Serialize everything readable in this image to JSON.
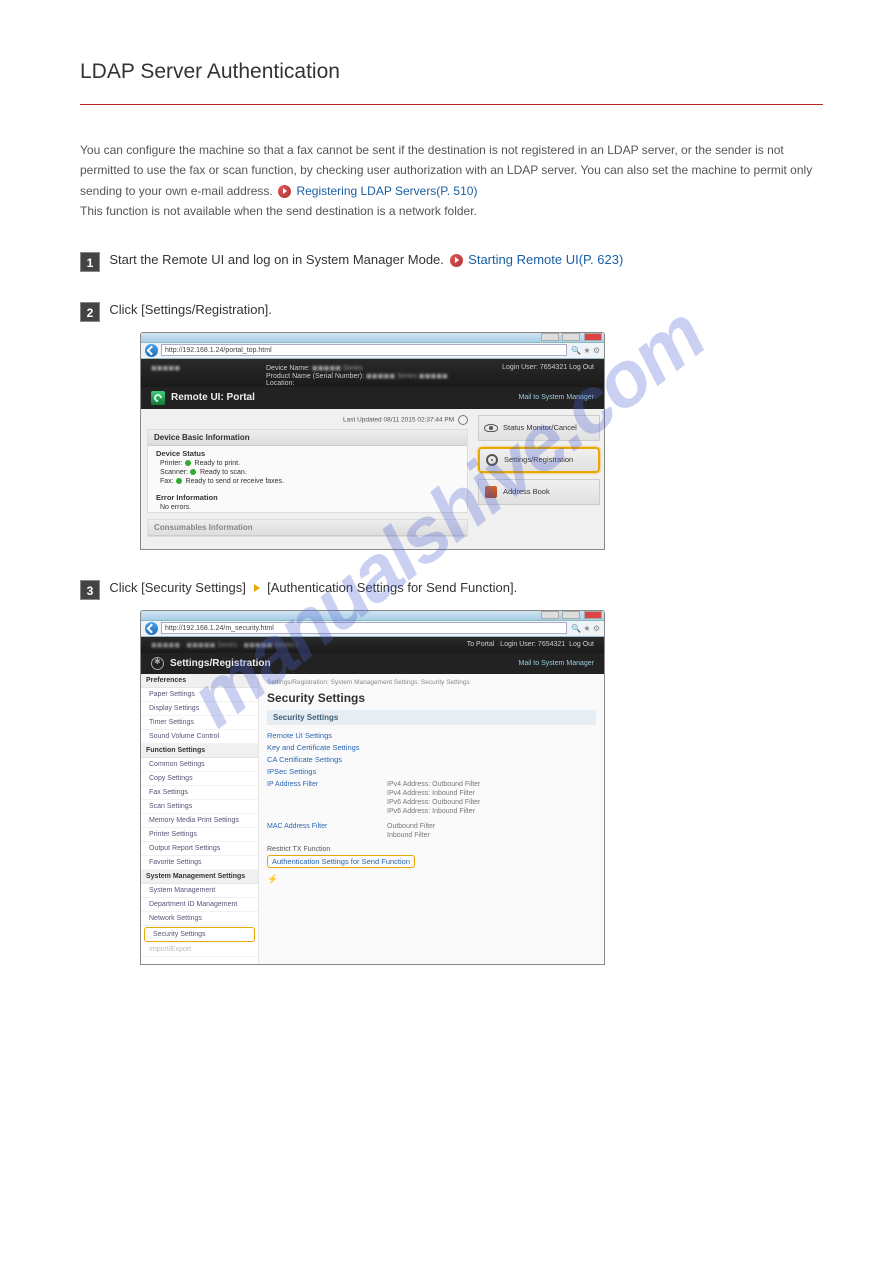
{
  "doc": {
    "title": "LDAP Server Authentication",
    "intro_1": "You can configure the machine so that a fax cannot be sent if the destination is not registered in an LDAP server, or the sender is not permitted to use the fax or scan function, by checking user authorization with an LDAP server. You can also set the machine to permit only sending to your own e-mail address.",
    "intro_link": "Registering LDAP Servers(P. 510)",
    "intro_link_prefix": " ",
    "intro_note": "This function is not available when the send destination is a network folder.",
    "step1": "Start the Remote UI and log on in System Manager Mode.",
    "step1_link": "Starting Remote UI(P. 623)",
    "step2": "Click [Settings/Registration].",
    "step3_prefix": "Click [Security Settings]",
    "step3_suffix": "[Authentication Settings for Send Function]."
  },
  "sc1": {
    "addr": "http://192.168.1.24/portal_top.html",
    "dev_name_lbl": "Device Name:",
    "prod_lbl": "Product Name (Serial Number):",
    "loc_lbl": "Location:",
    "login_user": "Login User:",
    "login_val": "7654321",
    "logout": "Log Out",
    "remoteui": "Remote UI: Portal",
    "mailto": "Mail to System Manager",
    "updated": "Last Updated 08/11 2015 02:37:44 PM",
    "basic_info": "Device Basic Information",
    "dev_status": "Device Status",
    "printer": "Printer:",
    "printer_val": "Ready to print.",
    "scanner": "Scanner:",
    "scanner_val": "Ready to scan.",
    "fax": "Fax:",
    "fax_val": "Ready to send or receive faxes.",
    "err_info": "Error Information",
    "no_errors": "No errors.",
    "consumables": "Consumables Information",
    "side_status": "Status Monitor/Cancel",
    "side_settings": "Settings/Registration",
    "side_addr": "Address Book"
  },
  "sc2": {
    "addr": "http://192.168.1.24/m_security.html",
    "to_portal": "To Portal",
    "login_user": "Login User:",
    "login_val": "7654321",
    "logout": "Log Out",
    "settings_reg": "Settings/Registration",
    "mailto": "Mail to System Manager",
    "crumb": "Settings/Registration: System Management Settings: Security Settings",
    "h1": "Security Settings",
    "sub": "Security Settings",
    "lnk_remote": "Remote UI Settings",
    "lnk_keycert": "Key and Certificate Settings",
    "lnk_cacert": "CA Certificate Settings",
    "lnk_ipsec": "IPSec Settings",
    "lnk_ipaddr": "IP Address Filter",
    "ip_out4": "IPv4 Address: Outbound Filter",
    "ip_in4": "IPv4 Address: Inbound Filter",
    "ip_out6": "IPv6 Address: Outbound Filter",
    "ip_in6": "IPv6 Address: Inbound Filter",
    "lnk_mac": "MAC Address Filter",
    "mac_out": "Outbound Filter",
    "mac_in": "Inbound Filter",
    "restrict": "Restrict TX Function",
    "auth_send": "Authentication Settings for Send Function",
    "ruler": "⚡",
    "left": {
      "prefs": "Preferences",
      "paper": "Paper Settings",
      "display": "Display Settings",
      "timer": "Timer Settings",
      "svol": "Sound Volume Control",
      "func": "Function Settings",
      "common": "Common Settings",
      "copy": "Copy Settings",
      "faxset": "Fax Settings",
      "scan": "Scan Settings",
      "memmedia": "Memory Media Print Settings",
      "printer": "Printer Settings",
      "outrep": "Output Report Settings",
      "fav": "Favorite Settings",
      "sysmgmt": "System Management Settings",
      "sysman": "System Management",
      "deptid": "Department ID Management",
      "network": "Network Settings",
      "security": "Security Settings",
      "impexp": "Import/Export"
    }
  },
  "watermark": "manualshive.com"
}
